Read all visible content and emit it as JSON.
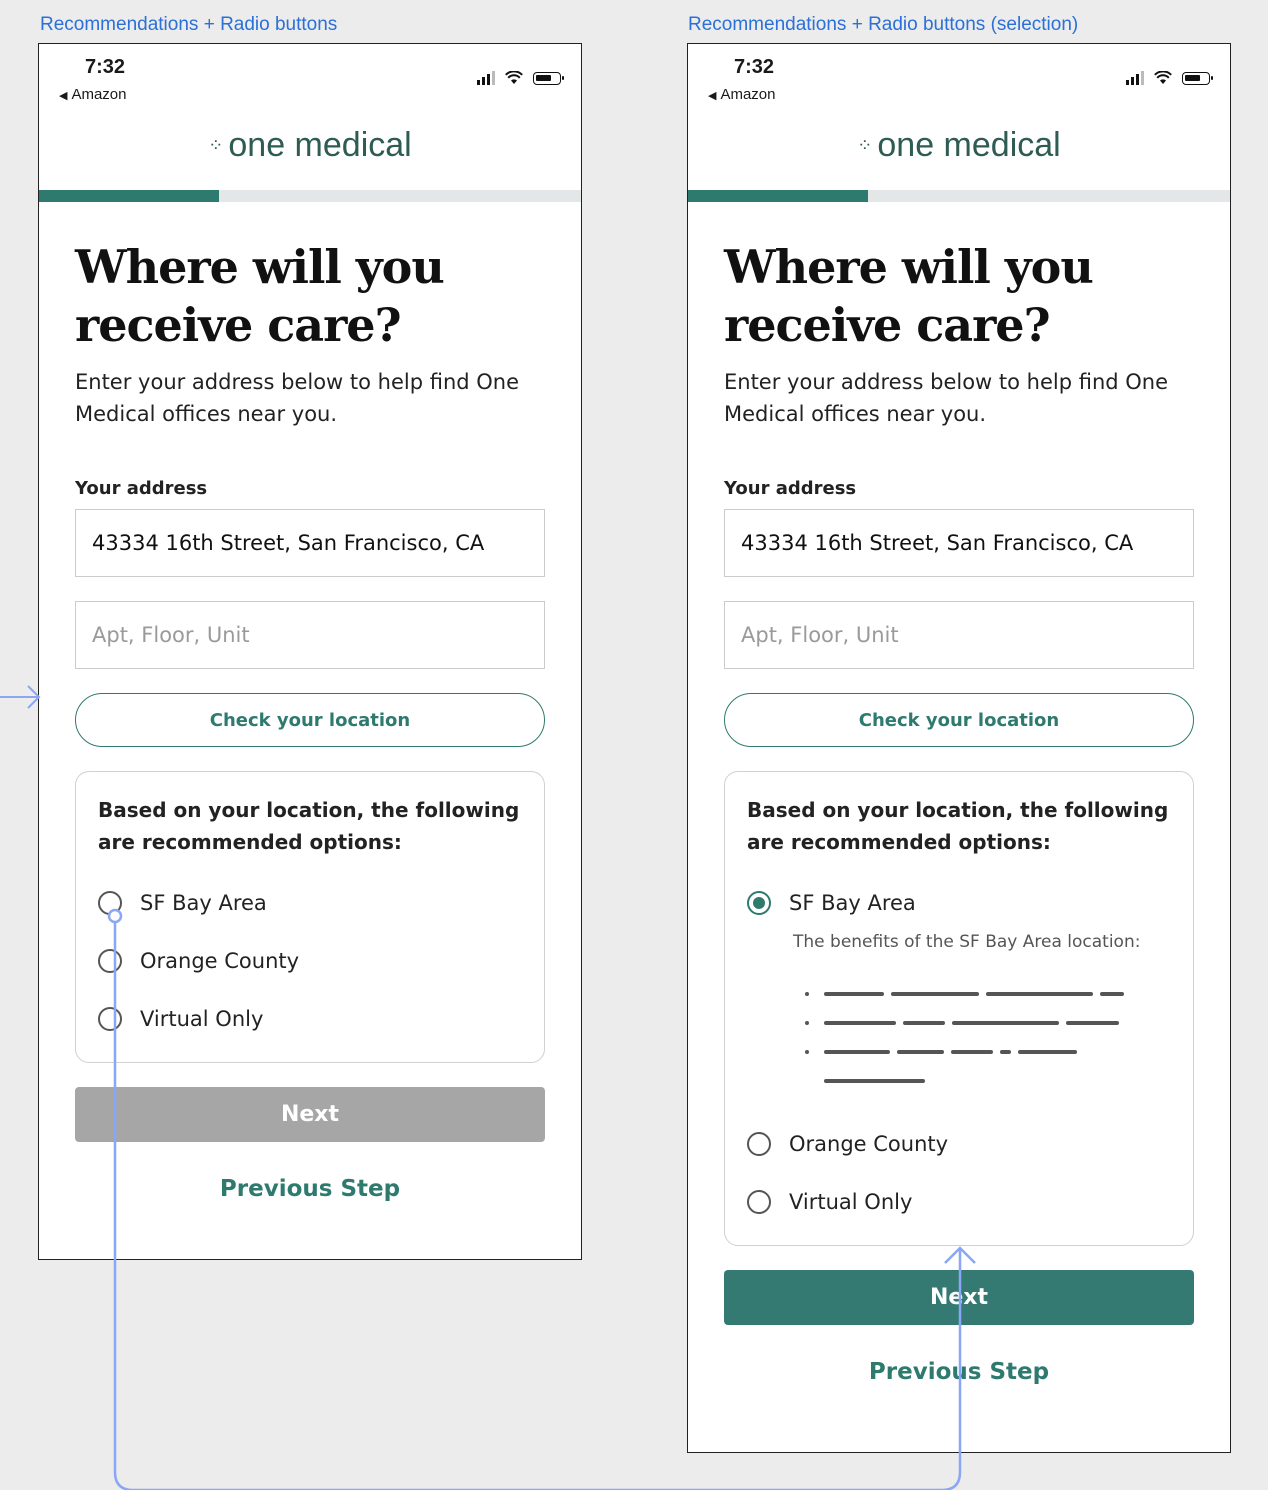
{
  "frames": [
    {
      "label": "Recommendations + Radio buttons",
      "status": {
        "time": "7:32",
        "back_app": "Amazon",
        "icons": [
          "signal-icon",
          "wifi-icon",
          "battery-icon"
        ]
      },
      "brand": {
        "logo_mark": "⁘",
        "name": "one medical"
      },
      "progress": {
        "value": 0.333
      },
      "title": "Where will you receive care?",
      "subtitle": "Enter your address below to help find One Medical offices near you.",
      "address_label": "Your address",
      "address_value": "43334 16th Street, San Francisco, CA",
      "apt_placeholder": "Apt, Floor, Unit",
      "check_location_label": "Check your location",
      "recommendation_title": "Based on your location, the following are recommended options:",
      "options": [
        {
          "label": "SF Bay Area",
          "selected": false
        },
        {
          "label": "Orange County",
          "selected": false
        },
        {
          "label": "Virtual Only",
          "selected": false
        }
      ],
      "next_label": "Next",
      "next_state": "disabled",
      "previous_label": "Previous Step"
    },
    {
      "label": "Recommendations + Radio buttons (selection)",
      "status": {
        "time": "7:32",
        "back_app": "Amazon",
        "icons": [
          "signal-icon",
          "wifi-icon",
          "battery-icon"
        ]
      },
      "brand": {
        "logo_mark": "⁘",
        "name": "one medical"
      },
      "progress": {
        "value": 0.333
      },
      "title": "Where will you receive care?",
      "subtitle": "Enter your address below to help find One Medical offices near you.",
      "address_label": "Your address",
      "address_value": "43334 16th Street, San Francisco, CA",
      "apt_placeholder": "Apt, Floor, Unit",
      "check_location_label": "Check your location",
      "recommendation_title": "Based on your location, the following are recommended options:",
      "options": [
        {
          "label": "SF Bay Area",
          "selected": true,
          "benefit_text": "The benefits of the SF Bay Area location:"
        },
        {
          "label": "Orange County",
          "selected": false
        },
        {
          "label": "Virtual Only",
          "selected": false
        }
      ],
      "next_label": "Next",
      "next_state": "active",
      "previous_label": "Previous Step"
    }
  ],
  "colors": {
    "brand_green": "#2f7a6f",
    "connector_blue": "#8aa6f5",
    "label_blue": "#2a70d8",
    "disabled_gray": "#a6a6a6"
  }
}
